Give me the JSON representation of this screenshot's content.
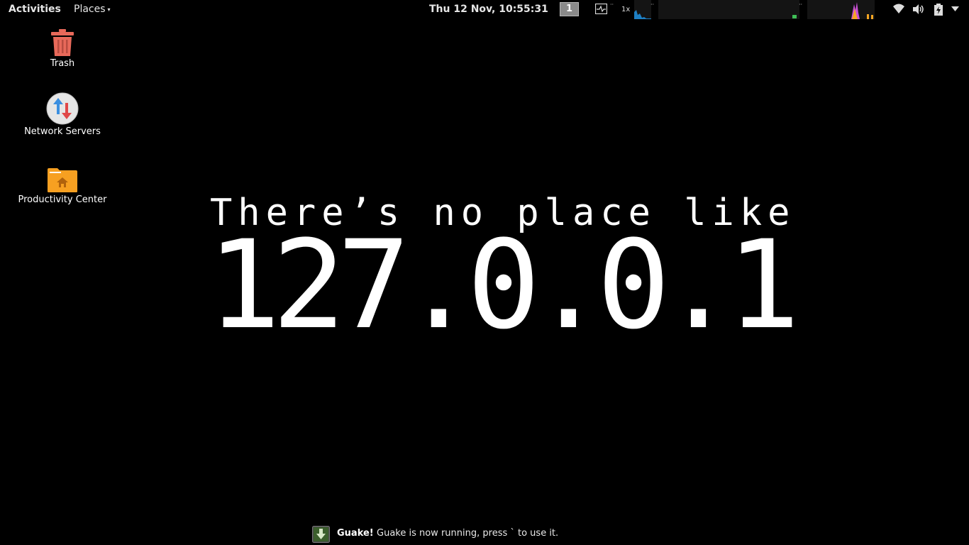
{
  "topbar": {
    "activities_label": "Activities",
    "places_label": "Places",
    "clock": "Thu 12 Nov, 10:55:31",
    "workspace_number": "1",
    "net_speed_label": "1x"
  },
  "desktop": {
    "icons": [
      {
        "label": "Trash",
        "icon": "trash-icon"
      },
      {
        "label": "Network Servers",
        "icon": "network-servers-icon"
      },
      {
        "label": "Productivity Center",
        "icon": "home-folder-icon"
      }
    ]
  },
  "wallpaper": {
    "tagline": "There’s no place like",
    "address": "127.0.0.1"
  },
  "notification": {
    "title": "Guake!",
    "body": "Guake is now running,  press ` to use it."
  },
  "colors": {
    "background": "#000000",
    "trash": "#e8695a",
    "folder": "#f7a021",
    "graph_cpu": "#1d7fc4",
    "graph_mem": "#c94fd8",
    "graph_load": "#f5a623",
    "graph_net": "#3fbf57"
  },
  "tray_icons": [
    "wifi-icon",
    "volume-icon",
    "battery-icon",
    "system-menu-chevron-icon"
  ]
}
